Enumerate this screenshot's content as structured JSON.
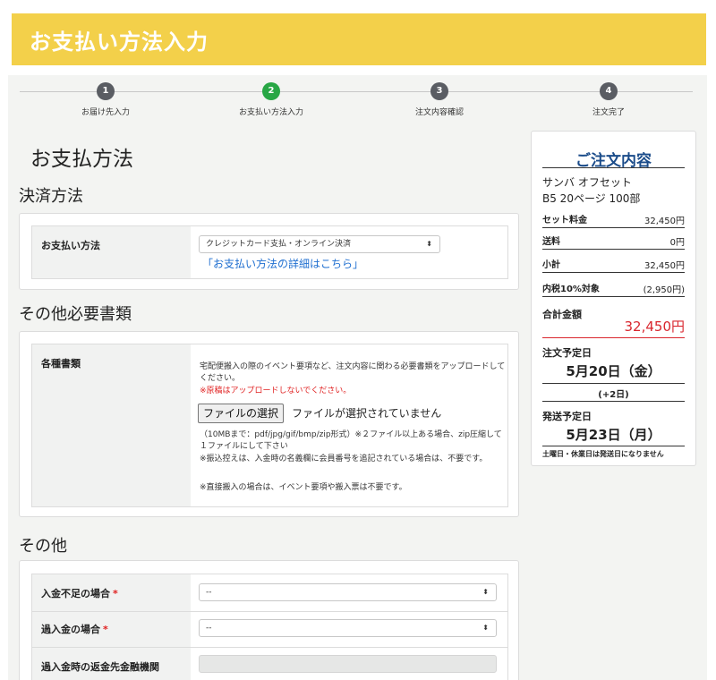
{
  "header": {
    "title": "お支払い方法入力"
  },
  "steps": [
    {
      "number": "1",
      "label": "お届け先入力"
    },
    {
      "number": "2",
      "label": "お支払い方法入力"
    },
    {
      "number": "3",
      "label": "注文内容確認"
    },
    {
      "number": "4",
      "label": "注文完了"
    }
  ],
  "page_title": "お支払方法",
  "payment": {
    "section_title": "決済方法",
    "label": "お支払い方法",
    "selected": "クレジットカード支払・オンライン決済",
    "details_link": "「お支払い方法の詳細はこちら」"
  },
  "documents": {
    "section_title": "その他必要書類",
    "label": "各種書類",
    "description": "宅配便搬入の際のイベント要項など、注文内容に関わる必要書類をアップロードしてください。",
    "warning": "※原稿はアップロードしないでください。",
    "file_button": "ファイルの選択",
    "file_status": "ファイルが選択されていません",
    "note1": "（10MBまで：pdf/jpg/gif/bmp/zip形式）※２ファイル以上ある場合、zip圧縮して１ファイルにして下さい",
    "note2": "※振込控えは、入金時の名義欄に会員番号を追記されている場合は、不要です。",
    "note3": "※直接搬入の場合は、イベント要項や搬入票は不要です。"
  },
  "other": {
    "section_title": "その他",
    "rows": [
      {
        "label": "入金不足の場合",
        "required": "*",
        "value": "--"
      },
      {
        "label": "過入金の場合",
        "required": "*",
        "value": "--"
      },
      {
        "label": "過入金時の返金先金融機関",
        "value": ""
      }
    ]
  },
  "summary": {
    "title": "ご注文内容",
    "product": "サンバ オフセット",
    "spec": "B5  20ページ 100部",
    "rows": [
      {
        "label": "セット料金",
        "value": "32,450円"
      },
      {
        "label": "送料",
        "value": "0円"
      },
      {
        "label": "小計",
        "value": "32,450円"
      },
      {
        "label": "内税10%対象",
        "value": "(2,950円)"
      }
    ],
    "total_label": "合計金額",
    "total_value": "32,450円",
    "order_date_label": "注文予定日",
    "order_date": "5月20日（金）",
    "offset": "(+2日)",
    "ship_date_label": "発送予定日",
    "ship_date": "5月23日（月）",
    "note": "土曜日・休業日は発送日になりません"
  },
  "colors": {
    "header": "#f3d04a",
    "active_step": "#28a745",
    "step": "#5a5d63",
    "link": "#1f6fd0",
    "price": "#d9262e",
    "summary_title": "#1b4c8a"
  }
}
